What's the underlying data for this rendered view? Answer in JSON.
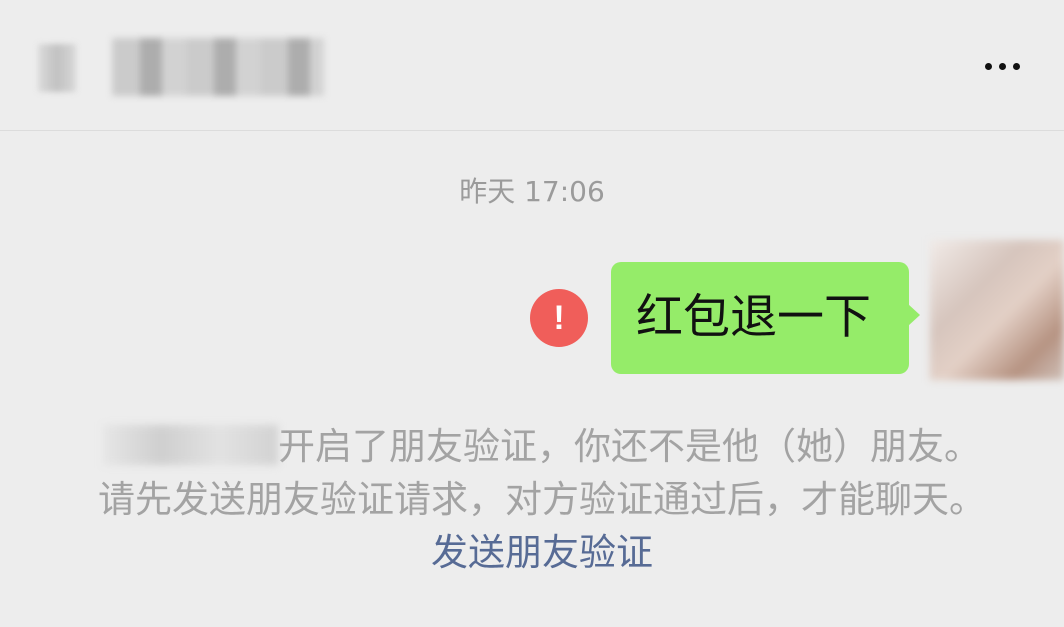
{
  "header": {
    "more_icon": "more-dots-icon"
  },
  "chat": {
    "timestamp": "昨天 17:06",
    "message": {
      "text": "红包退一下",
      "bubble_color": "#95ec69",
      "failed_icon_symbol": "!",
      "failed_icon_color": "#f05e5a"
    },
    "system_notice": {
      "text_part1": "开启了朋友验证，你还不是他（她）朋友。请先发送朋友验证请求，对方验证通过后，才能聊天。",
      "link_text": "发送朋友验证",
      "link_color": "#576b95"
    }
  }
}
